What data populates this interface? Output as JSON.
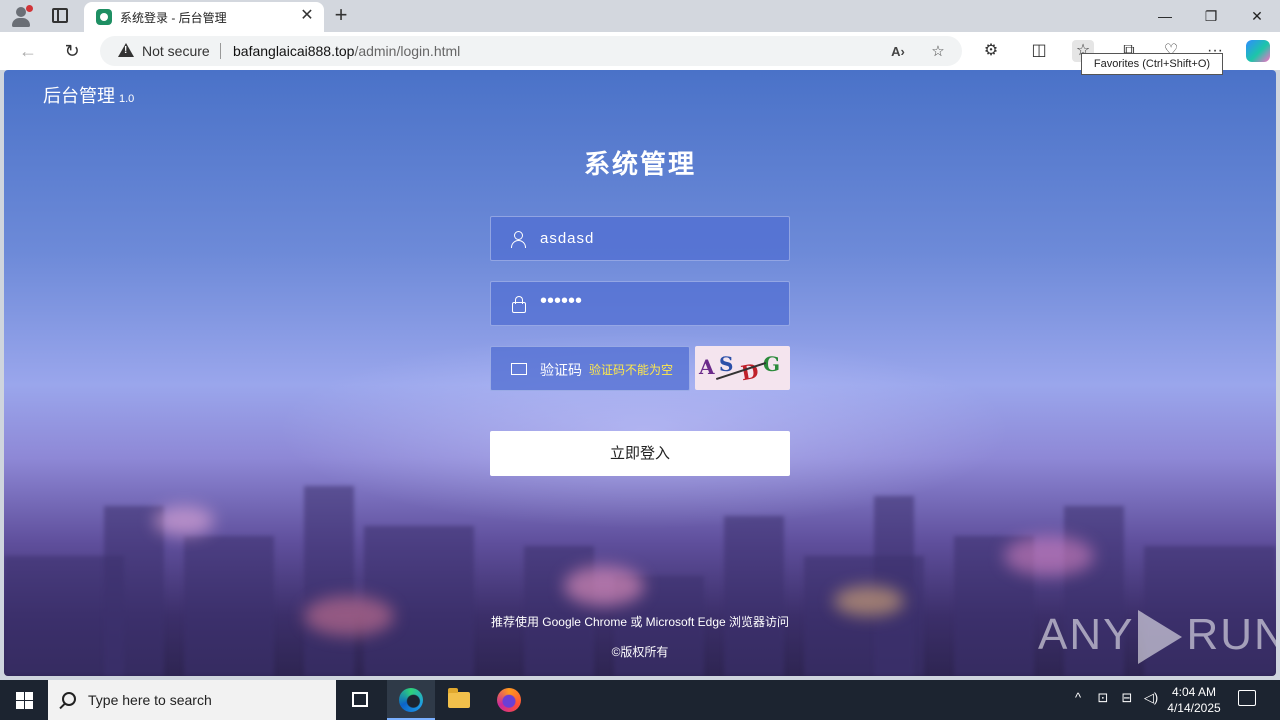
{
  "browser": {
    "tab_title": "系统登录 - 后台管理",
    "tab_close": "✕",
    "new_tab": "+",
    "window_controls": {
      "minimize": "—",
      "maximize": "❐",
      "close": "✕"
    },
    "nav": {
      "back": "←",
      "refresh": "↻"
    },
    "security_label": "Not secure",
    "url_domain": "bafanglaicai888.top",
    "url_path": "/admin/login.html",
    "read_aloud_icon": "A›",
    "add_favorite_icon": "☆",
    "toolbar": {
      "extensions": "⚙",
      "split": "◫",
      "favorites": "☆",
      "collections": "⧉",
      "performance": "♡",
      "more": "···"
    },
    "tooltip": "Favorites (Ctrl+Shift+O)"
  },
  "page": {
    "brand": "后台管理",
    "version": "1.0",
    "title": "系统管理",
    "username_value": "asdasd",
    "password_value": "••••••",
    "captcha_placeholder": "验证码",
    "captcha_error": "验证码不能为空",
    "captcha_chars": [
      "A",
      "S",
      "D",
      "G"
    ],
    "login_button": "立即登入",
    "browser_note": "推荐使用 Google Chrome 或 Microsoft Edge 浏览器访问",
    "copyright": "©版权所有",
    "watermark_left": "ANY",
    "watermark_right": "RUN"
  },
  "taskbar": {
    "search_placeholder": "Type here to search",
    "tray": {
      "chevron": "^",
      "a": "⊡",
      "net": "⊟",
      "vol": "◁)"
    },
    "time": "4:04 AM",
    "date": "4/14/2025"
  }
}
